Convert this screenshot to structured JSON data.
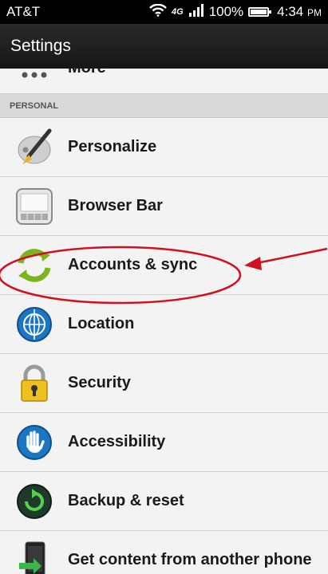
{
  "status_bar": {
    "carrier": "AT&T",
    "network": "4G",
    "battery": "100%",
    "time": "4:34",
    "ampm": "PM"
  },
  "app_bar": {
    "title": "Settings"
  },
  "list": {
    "partial_item": "More",
    "section_header": "PERSONAL",
    "items": [
      {
        "label": "Personalize",
        "icon": "personalize-brush-icon"
      },
      {
        "label": "Browser Bar",
        "icon": "browser-bar-icon"
      },
      {
        "label": "Accounts & sync",
        "icon": "sync-icon"
      },
      {
        "label": "Location",
        "icon": "globe-icon"
      },
      {
        "label": "Security",
        "icon": "lock-icon"
      },
      {
        "label": "Accessibility",
        "icon": "hand-icon"
      },
      {
        "label": "Backup & reset",
        "icon": "backup-icon"
      },
      {
        "label": "Get content from another phone",
        "icon": "transfer-phone-icon"
      }
    ]
  },
  "colors": {
    "annotation": "#d01020",
    "sync_green": "#7ab51d",
    "globe_blue": "#1c77c3"
  }
}
